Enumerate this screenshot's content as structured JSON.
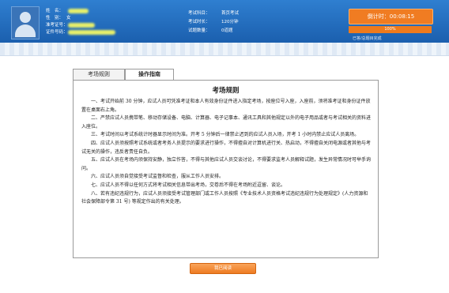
{
  "candidate": {
    "name_label": "姓　名：",
    "gender_label": "性　别：",
    "gender_value": "女",
    "id_label": "准考证号：",
    "cert_label": "证件号码："
  },
  "exam": {
    "subject_label": "考试科目：",
    "subject_value": "首页考试",
    "duration_label": "考试时长：",
    "duration_value": "120分钟",
    "questions_label": "试题数量：",
    "questions_value": "0道题"
  },
  "timer": {
    "label": "倒计时：",
    "value": "00:08:15"
  },
  "progress": {
    "percent_text": "100%",
    "fraction": 1.0,
    "hint": "已答/总题目完成"
  },
  "tabs": [
    {
      "label": "考场规则"
    },
    {
      "label": "操作指南"
    }
  ],
  "rules": {
    "title": "考场规则",
    "paragraphs": [
      "一、考试开始前 30 分钟，应试人员可凭准考证和本人有效身份证件进入指定考场，按座位号入座，入座前，须将准考证和身份证件放置在桌面右上角。",
      "二、严禁应试人员携带笔、移动存储设备、电脑、计算器、电子记事本、通讯工具和其他规定以外的电子用品或者与考试相关的资料进入座位。",
      "三、考试时间以考试系统计时器显示时间为准。开考 5 分钟后一律禁止迟到的应试人员入场，开考 1 小时内禁止应试人员离场。",
      "四、应试人员须按照考试系统或者考务人员提示的要求进行操作，不得擅自对计算机进行关、热启动，不得擅自关闭电源或者其他与考试无关的操作，违反者责任自负。",
      "五、应试人员在考场内须保持安静，独立作答，不得与其他应试人员交谈讨论，不得要求监考人员解释试题，发生异常情况时可举手询问。",
      "六、应试人员须自觉接受考试监督和检查，服从工作人员安排。",
      "七、应试人员不得以任何方式将考试相关信息带出考场，交卷后不得在考场附近逗留、谈论。",
      "八、若有违纪违规行为，应试人员须接受考试管理部门或工作人员按照《专业技术人员资格考试违纪违规行为处理规定》(人力资源和社会保障部令第 31 号) 等规定作出的有关处理。"
    ]
  },
  "confirm_button": {
    "label": "我已阅读"
  },
  "colors": {
    "header": "#1b5fae",
    "accent": "#ee7b22"
  }
}
